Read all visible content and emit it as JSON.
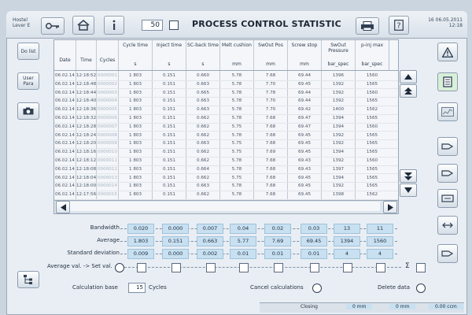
{
  "header": {
    "left_small": [
      "Hostel",
      "Lever E"
    ],
    "count": "50",
    "title": "PROCESS CONTROL STATISTIC",
    "right_small": [
      "16",
      "06.05.2011",
      "12:18"
    ]
  },
  "left_nav": [
    {
      "label": "Do list",
      "icon": ""
    },
    {
      "label": "User Para",
      "icon": ""
    },
    {
      "label": "",
      "icon": "camera-icon"
    }
  ],
  "columns": [
    {
      "name": "Date",
      "unit": ""
    },
    {
      "name": "Time",
      "unit": ""
    },
    {
      "name": "Cycles",
      "unit": ""
    },
    {
      "name": "Cycle time",
      "unit": "s"
    },
    {
      "name": "Inject time",
      "unit": "s"
    },
    {
      "name": "SC-back time",
      "unit": "s"
    },
    {
      "name": "Melt cushion",
      "unit": "mm"
    },
    {
      "name": "SwOut Pos",
      "unit": "mm"
    },
    {
      "name": "Screw stop",
      "unit": "mm"
    },
    {
      "name": "SwOut Pressure",
      "unit": "bar_spec"
    },
    {
      "name": "p-inj max",
      "unit": "bar_spec"
    }
  ],
  "rows": [
    [
      "06.02.14",
      "12:18:52",
      "0000001",
      "1 803",
      "0.151",
      "0.660",
      "5.78",
      "7.68",
      "69.44",
      "1396",
      "1560"
    ],
    [
      "06.02.14",
      "12:18:48",
      "0000002",
      "1 803",
      "0.151",
      "0.663",
      "5.78",
      "7.70",
      "69.45",
      "1392",
      "1565"
    ],
    [
      "06.02.14",
      "12:18:44",
      "0000003",
      "1 803",
      "0.151",
      "0.665",
      "5.78",
      "7.78",
      "69.44",
      "1392",
      "1560"
    ],
    [
      "06.02.14",
      "12:18:40",
      "0000004",
      "1 803",
      "0.151",
      "0.663",
      "5.78",
      "7.70",
      "69.44",
      "1392",
      "1565"
    ],
    [
      "06.02.14",
      "12:18:36",
      "0000005",
      "1 803",
      "0.151",
      "0.663",
      "5.78",
      "7.70",
      "69.42",
      "1400",
      "1562"
    ],
    [
      "06.02.14",
      "12:18:32",
      "0000006",
      "1 803",
      "0.151",
      "0.662",
      "5.78",
      "7.68",
      "69.47",
      "1394",
      "1565"
    ],
    [
      "06.02.14",
      "12:18:28",
      "0000007",
      "1 803",
      "0.151",
      "0.662",
      "5.75",
      "7.68",
      "69.47",
      "1394",
      "1560"
    ],
    [
      "06.02.14",
      "12:18:24",
      "0000008",
      "1 803",
      "0.151",
      "0.662",
      "5.78",
      "7.68",
      "69.45",
      "1392",
      "1565"
    ],
    [
      "06.02.14",
      "12:18:20",
      "0000009",
      "1 803",
      "0.151",
      "0.663",
      "5.75",
      "7.68",
      "69.45",
      "1392",
      "1565"
    ],
    [
      "06.02.14",
      "12:18:16",
      "0000010",
      "1 803",
      "0.151",
      "0.662",
      "5.75",
      "7.69",
      "69.45",
      "1394",
      "1565"
    ],
    [
      "06.02.14",
      "12:18:12",
      "0000011",
      "1 803",
      "0.151",
      "0.662",
      "5.78",
      "7.68",
      "69.43",
      "1392",
      "1560"
    ],
    [
      "06.02.14",
      "12:18:08",
      "0000012",
      "1 803",
      "0.151",
      "0.664",
      "5.78",
      "7.68",
      "69.43",
      "1397",
      "1565"
    ],
    [
      "06.02.14",
      "12:18:04",
      "0000013",
      "1 803",
      "0.151",
      "0.662",
      "5.75",
      "7.68",
      "69.45",
      "1394",
      "1565"
    ],
    [
      "06.02.14",
      "12:18:00",
      "0000014",
      "1 803",
      "0.151",
      "0.663",
      "5.78",
      "7.68",
      "69.45",
      "1392",
      "1565"
    ],
    [
      "06.02.14",
      "12:17:56",
      "0000015",
      "1 803",
      "0.151",
      "0.662",
      "5.78",
      "7.68",
      "69.45",
      "1398",
      "1562"
    ]
  ],
  "stats": {
    "bandwidth_label": "Bandwidth",
    "average_label": "Average",
    "stddev_label": "Standard deviation",
    "bandwidth": [
      "0.020",
      "0.000",
      "0.007",
      "0.04",
      "0.02",
      "0.03",
      "13",
      "11"
    ],
    "average": [
      "1.803",
      "0.151",
      "0.663",
      "5.77",
      "7.69",
      "69.45",
      "1394",
      "1560"
    ],
    "stddev": [
      "0.009",
      "0.000",
      "0.002",
      "0.01",
      "0.01",
      "0.01",
      "4",
      "4"
    ]
  },
  "setval": {
    "label": "Average val. -> Set val.",
    "sigma": "Σ"
  },
  "bottom": {
    "calc_label": "Calculation base",
    "calc_value": "15",
    "calc_unit": "Cycles",
    "cancel_label": "Cancel calculations",
    "delete_label": "Delete data"
  },
  "status": {
    "text": "Closing",
    "v1": "0 mm",
    "v2": "0 mm",
    "v3": "0.00 ccm"
  }
}
